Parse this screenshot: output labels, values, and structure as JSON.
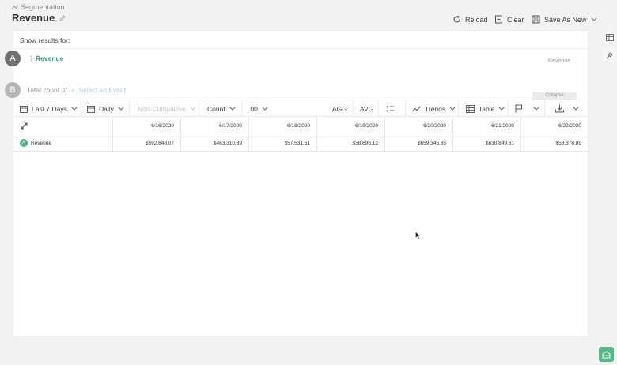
{
  "breadcrumb": {
    "label": "Segmentation"
  },
  "page": {
    "title": "Revenue"
  },
  "header": {
    "reload_label": "Reload",
    "clear_label": "Clear",
    "save_as_new_label": "Save As New"
  },
  "panel": {
    "results_label": "Show results for:",
    "event_a": {
      "badge": "A",
      "name": "Revenue",
      "right_label": "Revenue"
    },
    "event_b": {
      "badge": "B",
      "prefix": "Total count of",
      "placeholder": "Select an Event"
    },
    "collapse_label": "Collapse"
  },
  "toolbar": {
    "range_label": "Last 7 Days",
    "interval_label": "Daily",
    "cumulative_label": "Non-Cumulative",
    "metric_label": "Count",
    "decimals_label": ".00",
    "agg_label": "AGG",
    "avg_label": "AVG",
    "trends_label": "Trends",
    "table_label": "Table"
  },
  "table": {
    "columns": [
      "6/16/2020",
      "6/17/2020",
      "6/18/2020",
      "6/19/2020",
      "6/20/2020",
      "6/21/2020",
      "6/22/2020"
    ],
    "row": {
      "badge": "A",
      "label": "Revenue",
      "values": [
        "$592,648.07",
        "$463,310.89",
        "$57,531.51",
        "$58,696.12",
        "$659,345.85",
        "$630,849.61",
        "$58,378.89"
      ]
    }
  },
  "colors": {
    "accent": "#2aa36c",
    "badge_a": "#707070",
    "badge_b": "#b5b5b5",
    "row_badge": "#4bb57f"
  },
  "icons": [
    "segmentation-icon",
    "edit-pencil-icon",
    "reload-icon",
    "clear-icon",
    "save-icon",
    "chevron-down-icon",
    "calendar-icon",
    "trends-icon",
    "table-icon",
    "flag-icon",
    "download-icon",
    "swap-icon",
    "pin-icon",
    "help-icon"
  ]
}
